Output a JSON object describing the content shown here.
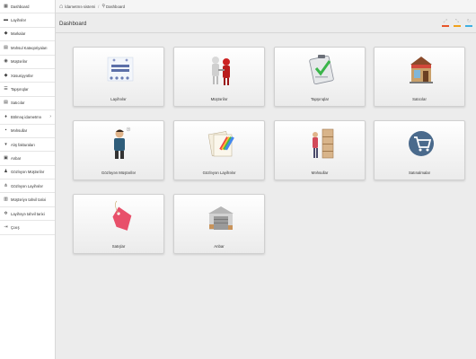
{
  "breadcrumb": {
    "home": "İdarəetmə sistemi",
    "current": "Dashboard"
  },
  "page": {
    "title": "Dashboard"
  },
  "sidebar": {
    "items": [
      {
        "label": "Dashboard"
      },
      {
        "label": "Layihələr"
      },
      {
        "label": "Markalar"
      },
      {
        "label": "Məhsul Kateqoriyaları"
      },
      {
        "label": "Müştərilər"
      },
      {
        "label": "Xüsusiyyətlər"
      },
      {
        "label": "Tapşırıqlar"
      },
      {
        "label": "Satıcılar"
      },
      {
        "label": "Bölməq idarəetmə"
      },
      {
        "label": "Məhsullar"
      },
      {
        "label": "Alış fakturaları"
      },
      {
        "label": "Anbar"
      },
      {
        "label": "Gözləyən Müştərilər"
      },
      {
        "label": "Gözləyən Layihələr"
      },
      {
        "label": "Müştəriyə tahvil tarixi"
      },
      {
        "label": "Layihəyə tahvil tarixi"
      },
      {
        "label": "Çıxış"
      }
    ]
  },
  "tiles": [
    {
      "label": "Layihələr"
    },
    {
      "label": "Müştərilər"
    },
    {
      "label": "Tapşırıqlar"
    },
    {
      "label": "Satıcılar"
    },
    {
      "label": "Gözləyən Müştərilər"
    },
    {
      "label": "Gözləyən Layihələr"
    },
    {
      "label": "Məhsullar"
    },
    {
      "label": "Satınalmalar"
    },
    {
      "label": "Satışlar"
    },
    {
      "label": "Anbar"
    }
  ],
  "colors": {
    "tool_bar_1": "#e8562a",
    "tool_bar_2": "#f0a21c",
    "tool_bar_3": "#3fb0e3",
    "basket_circle": "#4a6a8c",
    "sale_tag": "#e8506a"
  }
}
